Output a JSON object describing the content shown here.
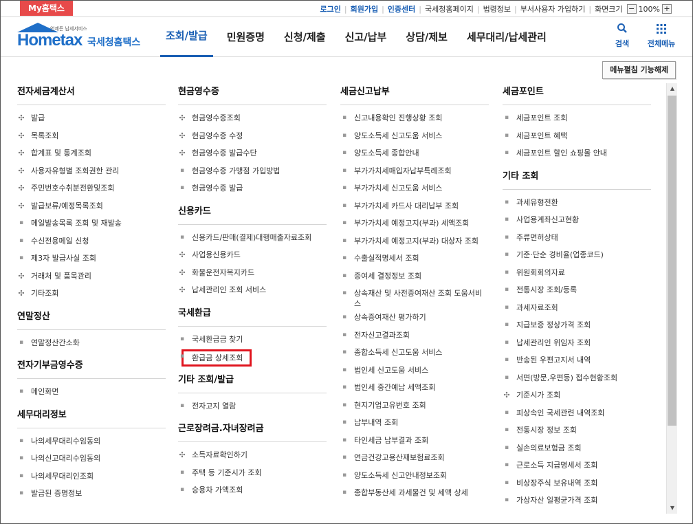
{
  "topbar": {
    "my_tab": "My홈택스",
    "links": [
      {
        "label": "로그인",
        "strong": true
      },
      {
        "label": "회원가입",
        "strong": true
      },
      {
        "label": "인증센터",
        "strong": true
      },
      {
        "label": "국세청홈페이지",
        "strong": false
      },
      {
        "label": "법령정보",
        "strong": false
      },
      {
        "label": "부서사용자 가입하기",
        "strong": false
      }
    ],
    "zoom_label": "화면크기",
    "zoom_minus": "−",
    "zoom_value": "100%",
    "zoom_plus": "+"
  },
  "header": {
    "logo_sub": "언제든 납세서비스",
    "logo_main": "Hometax",
    "logo_kr": "국세청홈택스",
    "nav": [
      "조회/발급",
      "민원증명",
      "신청/제출",
      "신고/납부",
      "상담/제보",
      "세무대리/납세관리"
    ],
    "active_nav": "조회/발급",
    "search_label": "검색",
    "allmenu_label": "전체메뉴"
  },
  "menu_toggle_label": "메뉴펼침 기능해제",
  "columns": [
    {
      "sections": [
        {
          "title": "전자세금계산서",
          "items": [
            {
              "label": "발급",
              "marker": "plus"
            },
            {
              "label": "목록조회",
              "marker": "plus"
            },
            {
              "label": "합계표 및 통계조회",
              "marker": "plus"
            },
            {
              "label": "사용자유형별 조회권한 관리",
              "marker": "plus"
            },
            {
              "label": "주민번호수취분전환및조회",
              "marker": "plus"
            },
            {
              "label": "발급보류/예정목록조회",
              "marker": "plus"
            },
            {
              "label": "메일발송목록 조회 및 재발송",
              "marker": "dot"
            },
            {
              "label": "수신전용메일 신청",
              "marker": "dot"
            },
            {
              "label": "제3자 발급사실 조회",
              "marker": "dot"
            },
            {
              "label": "거래처 및 품목관리",
              "marker": "plus"
            },
            {
              "label": "기타조회",
              "marker": "plus"
            }
          ]
        },
        {
          "title": "연말정산",
          "items": [
            {
              "label": "연말정산간소화",
              "marker": "dot"
            }
          ]
        },
        {
          "title": "전자기부금영수증",
          "items": [
            {
              "label": "메인화면",
              "marker": "dot"
            }
          ]
        },
        {
          "title": "세무대리정보",
          "items": [
            {
              "label": "나의세무대리수임동의",
              "marker": "dot"
            },
            {
              "label": "나의신고대리수임동의",
              "marker": "dot"
            },
            {
              "label": "나의세무대리인조회",
              "marker": "dot"
            },
            {
              "label": "발급된 증명정보",
              "marker": "dot"
            }
          ]
        }
      ]
    },
    {
      "sections": [
        {
          "title": "현금영수증",
          "items": [
            {
              "label": "현금영수증조회",
              "marker": "plus"
            },
            {
              "label": "현금영수증 수정",
              "marker": "plus"
            },
            {
              "label": "현금영수증 발급수단",
              "marker": "plus"
            },
            {
              "label": "현금영수증 가맹점 가입방법",
              "marker": "dot"
            },
            {
              "label": "현금영수증 발급",
              "marker": "dot"
            }
          ]
        },
        {
          "title": "신용카드",
          "items": [
            {
              "label": "신용카드/판매(결제)대행매출자료조회",
              "marker": "dot"
            },
            {
              "label": "사업용신용카드",
              "marker": "plus"
            },
            {
              "label": "화물운전자복지카드",
              "marker": "plus"
            },
            {
              "label": "납세관리인 조회 서비스",
              "marker": "plus"
            }
          ]
        },
        {
          "title": "국세환급",
          "items": [
            {
              "label": "국세환급금 찾기",
              "marker": "dot"
            },
            {
              "label": "환급금 상세조회",
              "marker": "dot",
              "highlight": true
            }
          ]
        },
        {
          "title": "기타 조회/발급",
          "items": [
            {
              "label": "전자고지 열람",
              "marker": "dot"
            }
          ]
        },
        {
          "title": "근로장려금.자녀장려금",
          "items": [
            {
              "label": "소득자료확인하기",
              "marker": "plus"
            },
            {
              "label": "주택 등 기준시가 조회",
              "marker": "dot"
            },
            {
              "label": "승용차 가액조회",
              "marker": "dot"
            }
          ]
        }
      ]
    },
    {
      "sections": [
        {
          "title": "세금신고납부",
          "items": [
            {
              "label": "신고내용확인 진행상황 조회",
              "marker": "dot"
            },
            {
              "label": "양도소득세 신고도움 서비스",
              "marker": "dot"
            },
            {
              "label": "양도소득세 종합안내",
              "marker": "dot"
            },
            {
              "label": "부가가치세매입자납부특례조회",
              "marker": "dot"
            },
            {
              "label": "부가가치세 신고도움 서비스",
              "marker": "dot"
            },
            {
              "label": "부가가치세 카드사 대리납부 조회",
              "marker": "dot"
            },
            {
              "label": "부가가치세 예정고지(부과) 세액조회",
              "marker": "dot"
            },
            {
              "label": "부가가치세 예정고지(부과) 대상자 조회",
              "marker": "dot",
              "wrap": true
            },
            {
              "label": "수출실적명세서 조회",
              "marker": "dot"
            },
            {
              "label": "증여세 결정정보 조회",
              "marker": "dot"
            },
            {
              "label": "상속재산 및 사전증여재산 조회 도움서비스",
              "marker": "dot",
              "wrap": true
            },
            {
              "label": "상속증여재산 평가하기",
              "marker": "dot"
            },
            {
              "label": "전자신고결과조회",
              "marker": "dot"
            },
            {
              "label": "종합소득세 신고도움 서비스",
              "marker": "dot"
            },
            {
              "label": "법인세 신고도움 서비스",
              "marker": "dot"
            },
            {
              "label": "법인세 중간예납 세액조회",
              "marker": "dot"
            },
            {
              "label": "현지기업고유번호 조회",
              "marker": "dot"
            },
            {
              "label": "납부내역 조회",
              "marker": "dot"
            },
            {
              "label": "타인세금 납부결과 조회",
              "marker": "dot"
            },
            {
              "label": "연금건강고용산재보험료조회",
              "marker": "dot"
            },
            {
              "label": "양도소득세 신고안내정보조회",
              "marker": "dot"
            },
            {
              "label": "종합부동산세 과세물건 및 세액 상세",
              "marker": "dot"
            }
          ]
        }
      ]
    },
    {
      "sections": [
        {
          "title": "세금포인트",
          "items": [
            {
              "label": "세금포인트 조회",
              "marker": "dot"
            },
            {
              "label": "세금포인트 혜택",
              "marker": "dot"
            },
            {
              "label": "세금포인트 할인 쇼핑몰 안내",
              "marker": "dot"
            }
          ]
        },
        {
          "title": "기타 조회",
          "items": [
            {
              "label": "과세유형전환",
              "marker": "dot"
            },
            {
              "label": "사업용계좌신고현황",
              "marker": "dot"
            },
            {
              "label": "주류면허상태",
              "marker": "dot"
            },
            {
              "label": "기준·단순 경비율(업종코드)",
              "marker": "dot"
            },
            {
              "label": "위원회회의자료",
              "marker": "dot"
            },
            {
              "label": "전통시장 조회/등록",
              "marker": "dot"
            },
            {
              "label": "과세자료조회",
              "marker": "dot"
            },
            {
              "label": "지급보증 정상가격 조회",
              "marker": "dot"
            },
            {
              "label": "납세관리인 위임자 조회",
              "marker": "dot"
            },
            {
              "label": "반송된 우편고지서 내역",
              "marker": "dot"
            },
            {
              "label": "서면(방문,우편등) 접수현황조회",
              "marker": "dot"
            },
            {
              "label": "기준시가 조회",
              "marker": "plus"
            },
            {
              "label": "피상속인 국세관련 내역조회",
              "marker": "dot"
            },
            {
              "label": "전통시장 정보 조회",
              "marker": "dot"
            },
            {
              "label": "실손의료보험금 조회",
              "marker": "dot"
            },
            {
              "label": "근로소득 지급명세서 조회",
              "marker": "dot"
            },
            {
              "label": "비상장주식 보유내역 조회",
              "marker": "dot"
            },
            {
              "label": "가상자산 일평균가격 조회",
              "marker": "dot"
            }
          ]
        }
      ]
    }
  ],
  "markers": {
    "plus": "✣",
    "dot": "▪"
  },
  "colors": {
    "accent": "#1a5fb4",
    "my_tab": "#e74a4a",
    "highlight": "#e0141e"
  },
  "scroll": {
    "up": "▲",
    "down": "▼"
  }
}
